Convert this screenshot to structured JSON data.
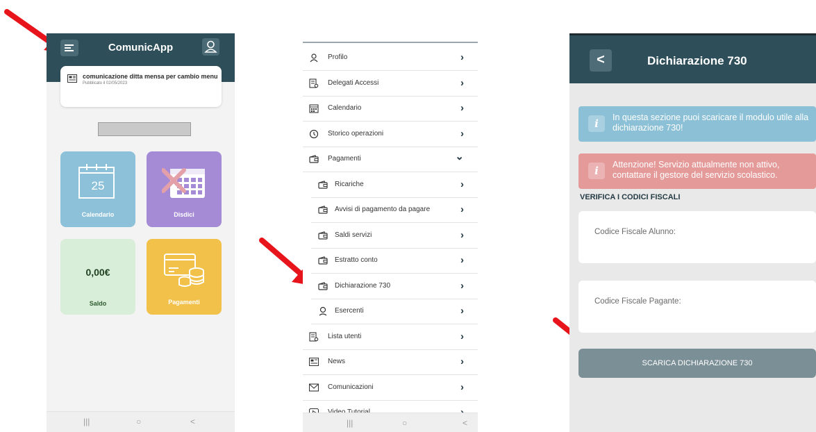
{
  "screen1": {
    "app_title": "ComunicApp",
    "news_card": {
      "title": "comunicazione ditta mensa per cambio menu",
      "date": "Pubblicato il 02/05/2023"
    },
    "tiles": {
      "calendar": {
        "label": "Calendario",
        "day": "25"
      },
      "cancel": {
        "label": "Disdici"
      },
      "balance": {
        "label": "Saldo",
        "value": "0,00€"
      },
      "payments": {
        "label": "Pagamenti"
      }
    },
    "navbar": {
      "recent": "|||",
      "home": "○",
      "back": "<"
    }
  },
  "screen2": {
    "menu": [
      {
        "label": "Profilo",
        "chevron": "›"
      },
      {
        "label": "Delegati Accessi",
        "chevron": "›"
      },
      {
        "label": "Calendario",
        "chevron": "›"
      },
      {
        "label": "Storico operazioni",
        "chevron": "›"
      },
      {
        "label": "Pagamenti",
        "chevron": "⌄"
      },
      {
        "label": "Ricariche",
        "chevron": "›"
      },
      {
        "label": "Avvisi di pagamento da pagare",
        "chevron": "›"
      },
      {
        "label": "Saldi servizi",
        "chevron": "›"
      },
      {
        "label": "Estratto conto",
        "chevron": "›"
      },
      {
        "label": "Dichiarazione 730",
        "chevron": "›"
      },
      {
        "label": "Esercenti",
        "chevron": "›"
      },
      {
        "label": "Lista utenti",
        "chevron": "›"
      },
      {
        "label": "News",
        "chevron": "›"
      },
      {
        "label": "Comunicazioni",
        "chevron": "›"
      },
      {
        "label": "Video Tutorial",
        "chevron": "›"
      }
    ],
    "navbar": {
      "recent": "|||",
      "home": "○",
      "back": "<"
    }
  },
  "screen3": {
    "title": "Dichiarazione 730",
    "back": "<",
    "info_alert": "In questa sezione puoi scaricare il modulo utile alla dichiarazione 730!",
    "warning_alert": "Attenzione! Servizio attualmente non attivo, contattare il gestore del servizio scolastico.",
    "info_icon": "i",
    "section_title": "VERIFICA I CODICI FISCALI",
    "field_student": "Codice Fiscale Alunno:",
    "field_payer": "Codice Fiscale Pagante:",
    "download_button": "SCARICA DICHIARAZIONE 730"
  },
  "colors": {
    "header": "#2e4e59",
    "arrow": "#e8141b",
    "tile_calendar": "#8dc1d9",
    "tile_cancel": "#a58ad6",
    "tile_balance": "#d8eed8",
    "tile_payments": "#f2c14a",
    "alert_info": "#8cc0d6",
    "alert_warning": "#e59a9a"
  }
}
